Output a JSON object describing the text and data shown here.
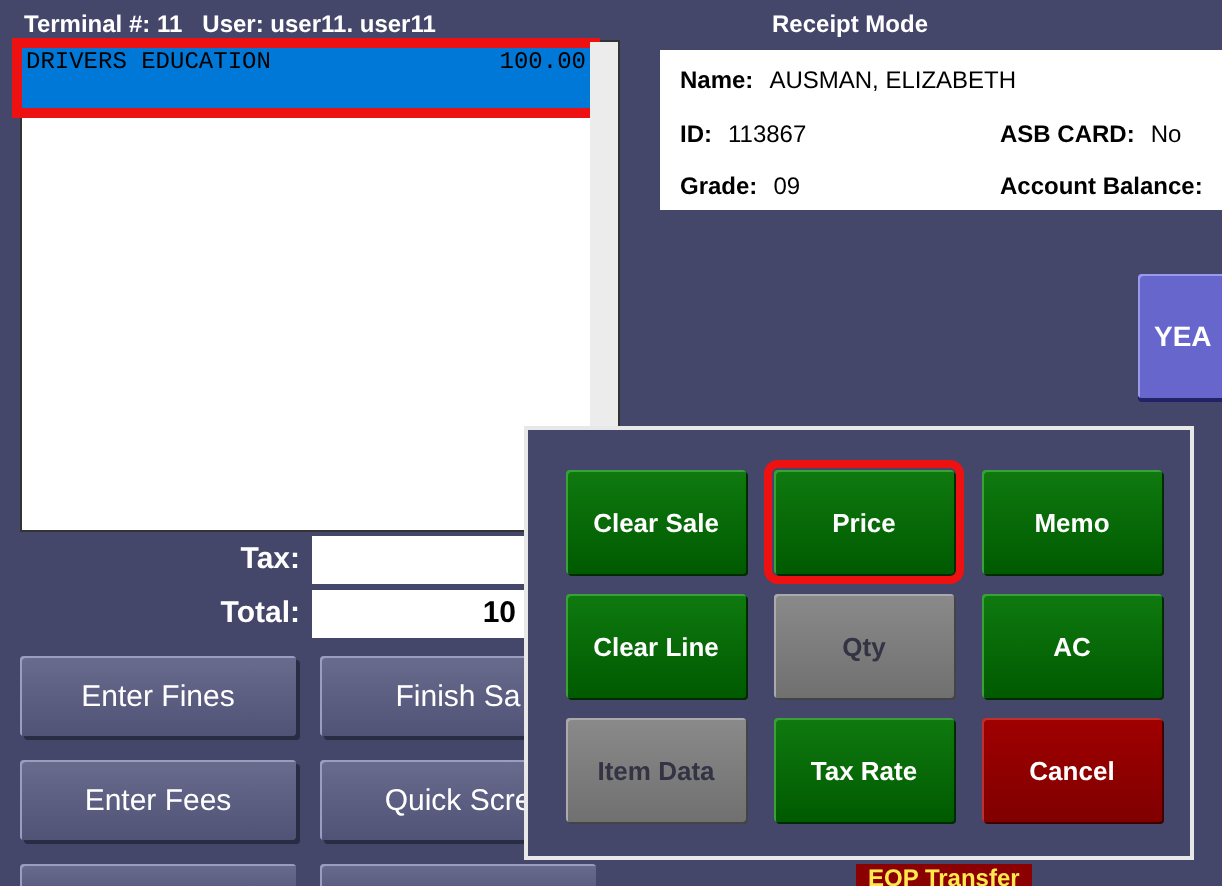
{
  "header": {
    "terminal": "Terminal #: 11",
    "user": "User: user11. user11",
    "mode": "Receipt Mode"
  },
  "sale_items": [
    {
      "name": "DRIVERS EDUCATION",
      "amount": "100.00",
      "selected": true,
      "outlined": true
    }
  ],
  "totals": [
    {
      "label": "Tax:"
    },
    {
      "label": "Total:",
      "value": "10"
    }
  ],
  "left_buttons": [
    {
      "label": "Enter Fines"
    },
    {
      "label": "Finish Sa"
    },
    {
      "label": "Enter Fees"
    },
    {
      "label": "Quick Scre"
    }
  ],
  "student": {
    "name_label": "Name:",
    "name": "AUSMAN, ELIZABETH",
    "id_label": "ID:",
    "id": "113867",
    "asb_label": "ASB CARD:",
    "asb": "No",
    "grade_label": "Grade:",
    "grade": "09",
    "balance_label": "Account Balance:"
  },
  "side_button": {
    "label": "YEA"
  },
  "popup_buttons": [
    {
      "label": "Clear Sale",
      "kind": "action",
      "disabled": false,
      "outlined": false
    },
    {
      "label": "Price",
      "kind": "action",
      "disabled": false,
      "outlined": true
    },
    {
      "label": "Memo",
      "kind": "action",
      "disabled": false,
      "outlined": false
    },
    {
      "label": "Clear Line",
      "kind": "action",
      "disabled": false,
      "outlined": false
    },
    {
      "label": "Qty",
      "kind": "action",
      "disabled": true,
      "outlined": false
    },
    {
      "label": "AC",
      "kind": "action",
      "disabled": false,
      "outlined": false
    },
    {
      "label": "Item Data",
      "kind": "action",
      "disabled": true,
      "outlined": false
    },
    {
      "label": "Tax Rate",
      "kind": "action",
      "disabled": false,
      "outlined": false
    },
    {
      "label": "Cancel",
      "kind": "cancel",
      "disabled": false,
      "outlined": false
    }
  ],
  "bottom_tag": {
    "label": "EOP Transfer"
  }
}
